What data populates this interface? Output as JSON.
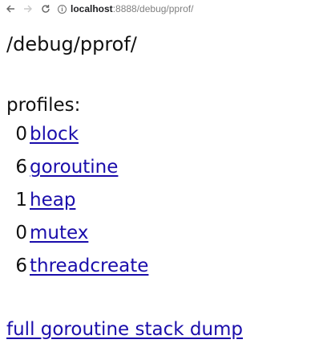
{
  "browser": {
    "back_icon": "back-arrow-icon",
    "forward_icon": "forward-arrow-icon",
    "reload_icon": "reload-icon",
    "info_icon": "info-icon",
    "url_host": "localhost",
    "url_rest": ":8888/debug/pprof/"
  },
  "page": {
    "title": "/debug/pprof/",
    "profiles_label": "profiles:",
    "profiles": [
      {
        "count": "0",
        "name": "block"
      },
      {
        "count": "6",
        "name": "goroutine"
      },
      {
        "count": "1",
        "name": "heap"
      },
      {
        "count": "0",
        "name": "mutex"
      },
      {
        "count": "6",
        "name": "threadcreate"
      }
    ],
    "full_dump_link": "full goroutine stack dump"
  },
  "colors": {
    "link": "#1a0dab",
    "text": "#111111"
  }
}
